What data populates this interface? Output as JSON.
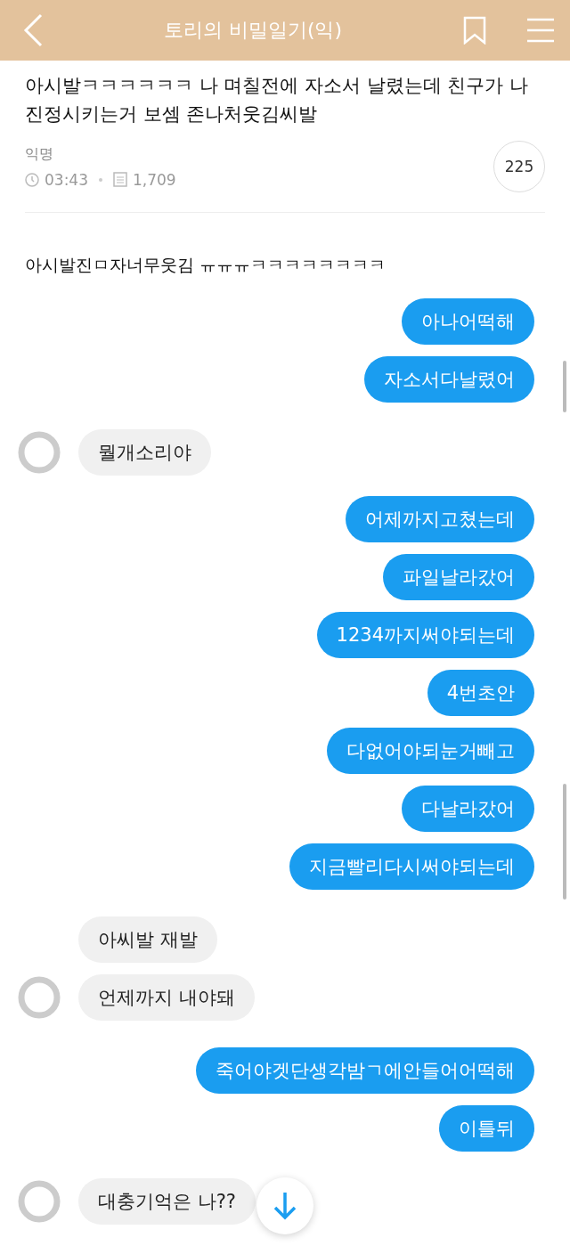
{
  "header": {
    "title": "토리의 비밀일기(익)"
  },
  "post": {
    "title": "아시발ㅋㅋㅋㅋㅋㅋ 나 며칠전에 자소서 날렸는데 친구가 나 진정시키는거 보셈 존나처웃김씨발",
    "author": "익명",
    "time": "03:43",
    "views": "1,709",
    "comments": "225",
    "body": "아시발진ㅁ자너무웃김 ㅠㅠㅠㅋㅋㅋㅋㅋㅋㅋㅋ"
  },
  "messages": [
    {
      "kind": "sent",
      "text": "아나어떡해"
    },
    {
      "kind": "sent",
      "text": "자소서다날렸어"
    },
    {
      "kind": "received",
      "text": "뭘개소리야",
      "avatar": true
    },
    {
      "kind": "sent",
      "text": "어제까지고쳤는데"
    },
    {
      "kind": "sent",
      "text": "파일날라갔어"
    },
    {
      "kind": "sent",
      "text": "1234까지써야되는데"
    },
    {
      "kind": "sent",
      "text": "4번초안"
    },
    {
      "kind": "sent",
      "text": "다없어야되눈거빼고"
    },
    {
      "kind": "sent",
      "text": "다날라갔어"
    },
    {
      "kind": "sent",
      "text": "지금빨리다시써야되는데"
    },
    {
      "kind": "received",
      "text": "아씨발 재발",
      "avatar": false
    },
    {
      "kind": "received",
      "text": "언제까지 내야돼",
      "avatar": true
    },
    {
      "kind": "sent",
      "text": "죽어야겟단생각밤ㄱ에안들어어떡해"
    },
    {
      "kind": "sent",
      "text": "이틀뒤"
    },
    {
      "kind": "received",
      "text": "대충기억은 나??",
      "avatar": true
    }
  ]
}
